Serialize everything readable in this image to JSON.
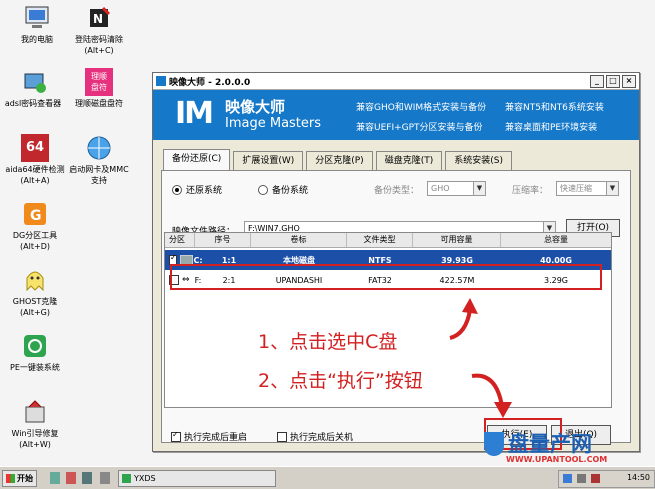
{
  "desktop_icons": [
    {
      "label": "我的电脑",
      "icon": "computer-icon"
    },
    {
      "label": "登陆密码清除\n(Alt+C)",
      "icon": "password-clear-icon"
    },
    {
      "label": "adsl密码查看器",
      "icon": "adsl-icon"
    },
    {
      "label": "理顺磁盘盘符",
      "icon": "disk-letter-icon"
    },
    {
      "label": "aida64硬件检测(Alt+A)",
      "icon": "aida64-icon",
      "badge": "64"
    },
    {
      "label": "启动网卡及MMC支持",
      "icon": "network-icon"
    },
    {
      "label": "DG分区工具\n(Alt+D)",
      "icon": "dg-icon"
    },
    {
      "label": "GHOST克隆\n(Alt+G)",
      "icon": "ghost-icon"
    },
    {
      "label": "PE一键装系统",
      "icon": "pe-install-icon"
    },
    {
      "label": "Win引导修复\n(Alt+W)",
      "icon": "boot-repair-icon"
    },
    {
      "disk_icon_badge": "理顺\n盘符"
    }
  ],
  "window": {
    "title": "映像大师 - 2.0.0.0",
    "brand_mark": "IM",
    "brand_cn": "映像大师",
    "brand_en": "Image Masters",
    "features": [
      "兼容GHO和WIM格式安装与备份",
      "兼容NT5和NT6系统安装",
      "兼容UEFI+GPT分区安装与备份",
      "兼容桌面和PE环境安装"
    ],
    "controls": {
      "minimize": "_",
      "maximize": "□",
      "close": "×"
    },
    "tabs": [
      "备份还原(C)",
      "扩展设置(W)",
      "分区克隆(P)",
      "磁盘克隆(T)",
      "系统安装(S)"
    ],
    "restore_label": "还原系统",
    "backup_label": "备份系统",
    "backup_type_label": "备份类型：",
    "backup_type_value": "GHO",
    "compress_label": "压缩率：",
    "compress_value": "快速压缩",
    "path_label": "映像文件路径：",
    "path_value": "F:\\WIN7.GHO",
    "open_button": "打开(O)",
    "table": {
      "headers": [
        "分区",
        "序号",
        "卷标",
        "文件类型",
        "可用容量",
        "总容量"
      ],
      "rows": [
        {
          "drive": "C:",
          "index": "1:1",
          "label": "本地磁盘",
          "fs": "NTFS",
          "free": "39.93G",
          "total": "40.00G",
          "checked": true
        },
        {
          "drive": "F:",
          "index": "2:1",
          "label": "UPANDASHI",
          "fs": "FAT32",
          "free": "422.57M",
          "total": "3.29G",
          "checked": false
        }
      ]
    },
    "restart_label": "执行完成后重启",
    "shutdown_label": "执行完成后关机",
    "execute_button": "执行(E)",
    "exit_button": "退出(Q)"
  },
  "annotations": {
    "step1": "1、点击选中C盘",
    "step2": "2、点击“执行”按钮"
  },
  "taskbar": {
    "start": "开始",
    "task": "YXDS",
    "clock": "14:50"
  },
  "watermark": {
    "cn": "盘量产网",
    "url": "WWW.UPANTOOL.COM"
  },
  "colors": {
    "banner": "#1578c8",
    "selection": "#1c4fa8",
    "annotation": "#d32020"
  }
}
